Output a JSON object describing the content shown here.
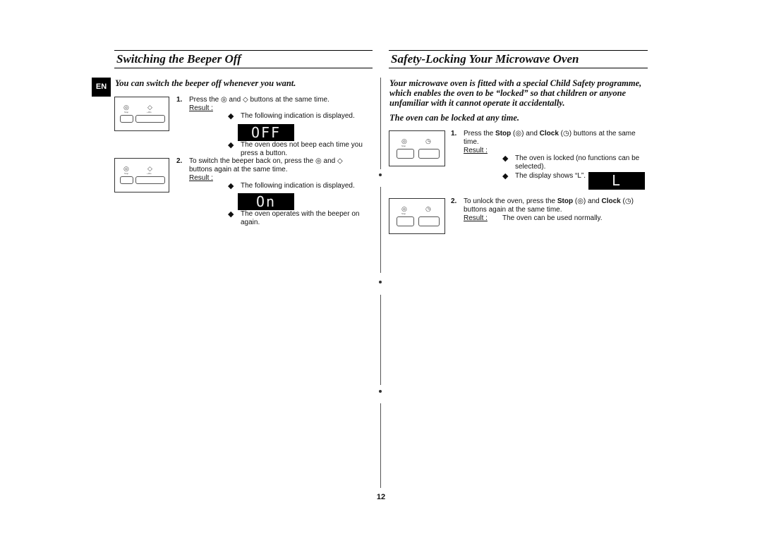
{
  "left": {
    "title": "Switching the Beeper Off",
    "lang_tab": "EN",
    "intro": "You can switch the beeper off whenever you want.",
    "panel_labels": {
      "stop": "Stop",
      "plus30": "+30s"
    },
    "step1_num": "1.",
    "step1_a": "Press the",
    "step1_b": "and",
    "step1_c": "buttons at the same time.",
    "result": "Result :",
    "s1_bullet1": "The following indication is displayed.",
    "s1_display": "OFF",
    "s1_bullet2": "The oven does not beep each time you press a button.",
    "step2_num": "2.",
    "step2_a": "To switch the beeper back on, press the",
    "step2_b": "and",
    "step2_c": "buttons again at the same time.",
    "s2_bullet1": "The following indication is displayed.",
    "s2_display": "On",
    "s2_bullet2": "The oven operates with the beeper on again."
  },
  "right": {
    "title": "Safety-Locking Your Microwave Oven",
    "intro1": "Your microwave oven is fitted with a special Child Safety programme, which enables the oven to be “locked” so that children or anyone unfamiliar with it cannot operate it accidentally.",
    "intro2": "The oven can be locked at any time.",
    "panel_labels": {
      "stop": "Stop"
    },
    "step1_num": "1.",
    "press": "Press the",
    "stop": "Stop",
    "and": "and",
    "clock": "Clock",
    "step1_tail": "buttons at the same time.",
    "result": "Result :",
    "s1_bullet1": "The oven is locked (no functions can be selected).",
    "s1_bullet2": "The display shows “L”.",
    "s1_display": "L",
    "step2_num": "2.",
    "step2_a": "To unlock the oven, press the",
    "step2_tail": "buttons again at the same time.",
    "s2_result": "The oven can be used normally."
  },
  "page_number": "12"
}
